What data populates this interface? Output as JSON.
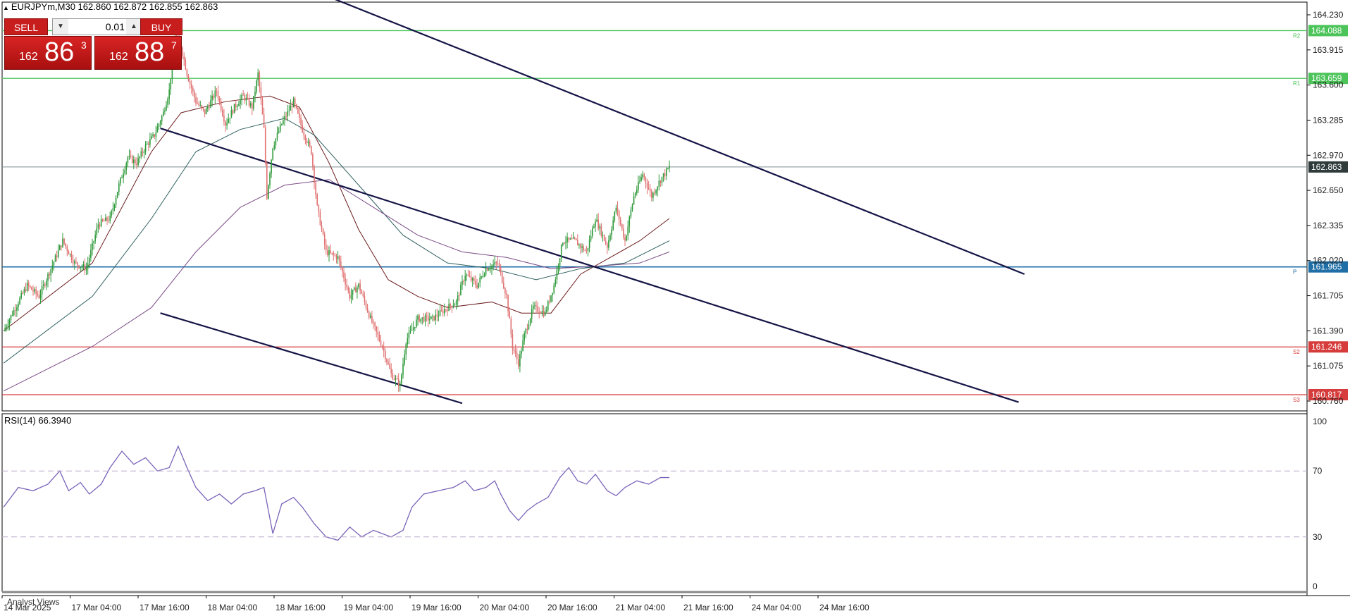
{
  "header": {
    "symbol_line": "EURJPYm,M30  162.860 162.872 162.855 162.863"
  },
  "trade_panel": {
    "sell_label": "SELL",
    "buy_label": "BUY",
    "lot_value": "0.01",
    "sell_price": {
      "prefix": "162",
      "big": "86",
      "sup": "3"
    },
    "buy_price": {
      "prefix": "162",
      "big": "88",
      "sup": "7"
    }
  },
  "indicator": {
    "label": "RSI(14) 66.3940",
    "levels": [
      "100",
      "70",
      "30",
      "0"
    ]
  },
  "bottom_label": "Analyst Views",
  "colors": {
    "bull": "#2e9a3a",
    "bear": "#e07070",
    "resistance": "#4cc45a",
    "support": "#d63c3c",
    "pivot": "#1f6fa6",
    "trend": "#141446",
    "rsi": "#7a63b8"
  },
  "chart_data": [
    {
      "type": "candlestick",
      "price_axis_ticks": [
        "164.230",
        "163.915",
        "163.600",
        "163.285",
        "162.970",
        "162.650",
        "162.335",
        "162.020",
        "161.705",
        "161.390",
        "161.075",
        "160.760"
      ],
      "time_axis_ticks": [
        "14 Mar 2025",
        "17 Mar 04:00",
        "17 Mar 16:00",
        "18 Mar 04:00",
        "18 Mar 16:00",
        "19 Mar 04:00",
        "19 Mar 16:00",
        "20 Mar 04:00",
        "20 Mar 16:00",
        "21 Mar 04:00",
        "21 Mar 16:00",
        "24 Mar 04:00",
        "24 Mar 16:00"
      ],
      "horizontal_levels": [
        {
          "name": "R2",
          "value": 164.088,
          "label": "164.088",
          "kind": "resistance"
        },
        {
          "name": "R1",
          "value": 163.659,
          "label": "163.659",
          "kind": "resistance"
        },
        {
          "name": "P",
          "value": 161.965,
          "label": "161.965",
          "kind": "pivot"
        },
        {
          "name": "S2",
          "value": 161.246,
          "label": "161.246",
          "kind": "support"
        },
        {
          "name": "S3",
          "value": 160.817,
          "label": "160.817",
          "kind": "support"
        }
      ],
      "current_price": {
        "value": 162.863,
        "label": "162.863"
      },
      "close_path": [
        [
          0,
          161.39
        ],
        [
          8,
          161.6
        ],
        [
          16,
          161.8
        ],
        [
          24,
          161.7
        ],
        [
          32,
          161.95
        ],
        [
          40,
          162.2
        ],
        [
          48,
          162.0
        ],
        [
          56,
          161.95
        ],
        [
          64,
          162.35
        ],
        [
          72,
          162.4
        ],
        [
          78,
          162.7
        ],
        [
          84,
          162.95
        ],
        [
          90,
          162.9
        ],
        [
          96,
          163.05
        ],
        [
          102,
          163.15
        ],
        [
          108,
          163.35
        ],
        [
          112,
          163.55
        ],
        [
          116,
          164.05
        ],
        [
          120,
          163.95
        ],
        [
          124,
          163.7
        ],
        [
          130,
          163.45
        ],
        [
          136,
          163.35
        ],
        [
          144,
          163.55
        ],
        [
          150,
          163.25
        ],
        [
          156,
          163.4
        ],
        [
          162,
          163.5
        ],
        [
          168,
          163.4
        ],
        [
          172,
          163.7
        ],
        [
          176,
          163.2
        ],
        [
          178,
          162.6
        ],
        [
          182,
          163.05
        ],
        [
          188,
          163.25
        ],
        [
          196,
          163.45
        ],
        [
          202,
          163.2
        ],
        [
          208,
          163.0
        ],
        [
          212,
          162.5
        ],
        [
          218,
          162.1
        ],
        [
          226,
          162.05
        ],
        [
          234,
          161.7
        ],
        [
          240,
          161.8
        ],
        [
          248,
          161.5
        ],
        [
          256,
          161.25
        ],
        [
          262,
          161.0
        ],
        [
          268,
          160.9
        ],
        [
          272,
          161.3
        ],
        [
          280,
          161.5
        ],
        [
          290,
          161.5
        ],
        [
          300,
          161.6
        ],
        [
          306,
          161.65
        ],
        [
          312,
          161.9
        ],
        [
          320,
          161.8
        ],
        [
          326,
          161.95
        ],
        [
          334,
          162.0
        ],
        [
          340,
          161.7
        ],
        [
          344,
          161.25
        ],
        [
          348,
          161.1
        ],
        [
          352,
          161.35
        ],
        [
          358,
          161.6
        ],
        [
          366,
          161.55
        ],
        [
          372,
          161.8
        ],
        [
          378,
          162.2
        ],
        [
          386,
          162.2
        ],
        [
          394,
          162.1
        ],
        [
          400,
          162.4
        ],
        [
          408,
          162.15
        ],
        [
          414,
          162.5
        ],
        [
          420,
          162.2
        ],
        [
          426,
          162.6
        ],
        [
          432,
          162.8
        ],
        [
          438,
          162.6
        ],
        [
          444,
          162.75
        ],
        [
          450,
          162.86
        ]
      ],
      "moving_averages": {
        "fast": [
          [
            0,
            161.39
          ],
          [
            60,
            162.0
          ],
          [
            100,
            163.0
          ],
          [
            120,
            163.35
          ],
          [
            150,
            163.45
          ],
          [
            180,
            163.5
          ],
          [
            200,
            163.4
          ],
          [
            220,
            162.9
          ],
          [
            240,
            162.3
          ],
          [
            260,
            161.85
          ],
          [
            280,
            161.7
          ],
          [
            300,
            161.6
          ],
          [
            330,
            161.65
          ],
          [
            350,
            161.55
          ],
          [
            370,
            161.55
          ],
          [
            390,
            161.9
          ],
          [
            410,
            162.05
          ],
          [
            430,
            162.2
          ],
          [
            450,
            162.4
          ]
        ],
        "medium": [
          [
            0,
            161.1
          ],
          [
            60,
            161.7
          ],
          [
            100,
            162.4
          ],
          [
            130,
            163.0
          ],
          [
            160,
            163.2
          ],
          [
            190,
            163.3
          ],
          [
            210,
            163.15
          ],
          [
            240,
            162.7
          ],
          [
            270,
            162.25
          ],
          [
            300,
            162.0
          ],
          [
            330,
            161.95
          ],
          [
            360,
            161.85
          ],
          [
            390,
            161.95
          ],
          [
            420,
            162.0
          ],
          [
            450,
            162.2
          ]
        ],
        "slow": [
          [
            0,
            160.85
          ],
          [
            60,
            161.25
          ],
          [
            100,
            161.6
          ],
          [
            130,
            162.1
          ],
          [
            160,
            162.5
          ],
          [
            190,
            162.7
          ],
          [
            220,
            162.75
          ],
          [
            250,
            162.5
          ],
          [
            280,
            162.25
          ],
          [
            310,
            162.1
          ],
          [
            340,
            162.05
          ],
          [
            370,
            161.95
          ],
          [
            400,
            161.97
          ],
          [
            430,
            162.0
          ],
          [
            450,
            162.1
          ]
        ]
      },
      "trend_lines": [
        {
          "from": [
            190,
            164.55
          ],
          "to": [
            690,
            161.9
          ]
        },
        {
          "from": [
            106,
            163.21
          ],
          "to": [
            686,
            160.75
          ]
        },
        {
          "from": [
            106,
            161.55
          ],
          "to": [
            310,
            160.74
          ]
        }
      ]
    },
    {
      "type": "line",
      "title": "RSI(14) 66.3940",
      "ylim": [
        0,
        100
      ],
      "reference_lines": [
        70,
        30
      ],
      "y": [
        [
          0,
          48
        ],
        [
          10,
          60
        ],
        [
          20,
          58
        ],
        [
          30,
          62
        ],
        [
          38,
          70
        ],
        [
          44,
          58
        ],
        [
          52,
          63
        ],
        [
          58,
          56
        ],
        [
          66,
          62
        ],
        [
          72,
          72
        ],
        [
          80,
          82
        ],
        [
          88,
          74
        ],
        [
          96,
          78
        ],
        [
          104,
          70
        ],
        [
          112,
          72
        ],
        [
          118,
          85
        ],
        [
          124,
          72
        ],
        [
          130,
          60
        ],
        [
          138,
          52
        ],
        [
          146,
          56
        ],
        [
          154,
          50
        ],
        [
          162,
          56
        ],
        [
          170,
          58
        ],
        [
          176,
          60
        ],
        [
          182,
          32
        ],
        [
          188,
          50
        ],
        [
          196,
          54
        ],
        [
          202,
          48
        ],
        [
          210,
          38
        ],
        [
          218,
          30
        ],
        [
          226,
          28
        ],
        [
          234,
          36
        ],
        [
          242,
          30
        ],
        [
          250,
          34
        ],
        [
          256,
          32
        ],
        [
          262,
          30
        ],
        [
          270,
          34
        ],
        [
          276,
          48
        ],
        [
          284,
          56
        ],
        [
          294,
          58
        ],
        [
          304,
          60
        ],
        [
          312,
          64
        ],
        [
          318,
          58
        ],
        [
          326,
          60
        ],
        [
          332,
          64
        ],
        [
          336,
          56
        ],
        [
          342,
          46
        ],
        [
          348,
          40
        ],
        [
          354,
          46
        ],
        [
          360,
          50
        ],
        [
          368,
          54
        ],
        [
          376,
          66
        ],
        [
          382,
          72
        ],
        [
          388,
          64
        ],
        [
          394,
          62
        ],
        [
          400,
          68
        ],
        [
          408,
          58
        ],
        [
          414,
          55
        ],
        [
          420,
          60
        ],
        [
          428,
          64
        ],
        [
          436,
          62
        ],
        [
          444,
          66
        ],
        [
          450,
          66
        ]
      ]
    }
  ]
}
